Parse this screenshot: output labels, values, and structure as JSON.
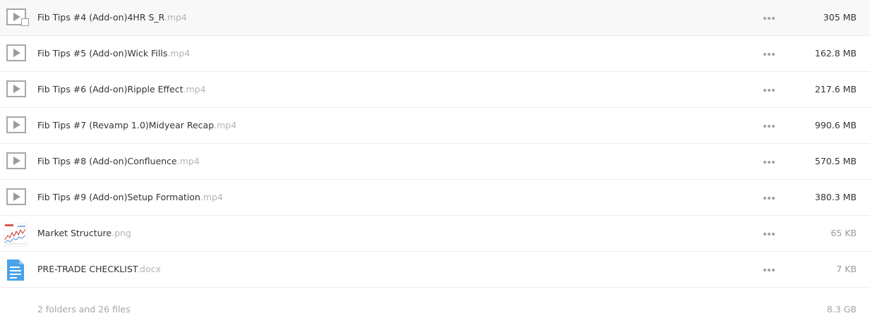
{
  "files": [
    {
      "name": "Fib Tips #4 (Add-on)4HR S_R",
      "ext": ".mp4",
      "size": "305 MB",
      "type": "video",
      "hover": true
    },
    {
      "name": "Fib Tips #5 (Add-on)Wick Fills",
      "ext": ".mp4",
      "size": "162.8 MB",
      "type": "video"
    },
    {
      "name": "Fib Tips #6 (Add-on)Ripple Effect",
      "ext": ".mp4",
      "size": "217.6 MB",
      "type": "video"
    },
    {
      "name": "Fib Tips #7 (Revamp 1.0)Midyear Recap",
      "ext": ".mp4",
      "size": "990.6 MB",
      "type": "video"
    },
    {
      "name": "Fib Tips #8 (Add-on)Confluence",
      "ext": ".mp4",
      "size": "570.5 MB",
      "type": "video"
    },
    {
      "name": "Fib Tips #9 (Add-on)Setup Formation",
      "ext": ".mp4",
      "size": "380.3 MB",
      "type": "video"
    },
    {
      "name": "Market Structure",
      "ext": ".png",
      "size": "65 KB",
      "type": "image"
    },
    {
      "name": "PRE-TRADE CHECKLIST",
      "ext": ".docx",
      "size": "7 KB",
      "type": "document"
    }
  ],
  "footer": {
    "summary": "2 folders and 26 files",
    "total": "8.3 GB"
  },
  "icons": {
    "video": "play-icon",
    "image": "image-thumbnail",
    "document": "document-icon",
    "more": "more-options-icon"
  },
  "colors": {
    "extension": "#b4b4b4",
    "document_blue": "#4aa3e8",
    "footer_text": "#a6a6a6"
  }
}
